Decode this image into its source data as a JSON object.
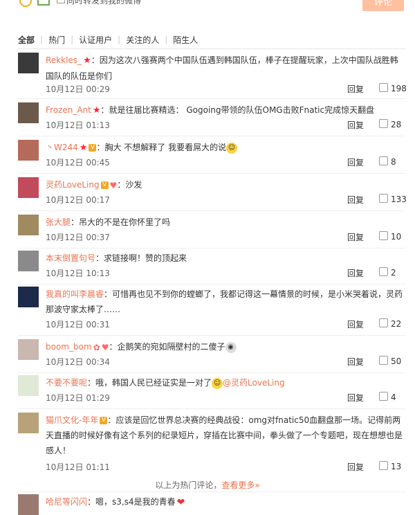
{
  "topbar": {
    "checkbox_label": "同时转发到我的微博",
    "submit_label": "评论"
  },
  "tabs": [
    "全部",
    "热门",
    "认证用户",
    "关注的人",
    "陌生人"
  ],
  "comments": [
    {
      "user": "Rekkles_",
      "text": "因为这次八强赛两个中国队伍遇到韩国队伍，棒子在提醒玩家，上次中国队战胜韩国队的队伍是你们",
      "time": "10月12日 00:29",
      "reply": "回复",
      "likes": "198",
      "avatar": "#3a3a3a"
    },
    {
      "user": "Frozen_Ant",
      "text": "就是往届比赛精选： Gogoing带领的队伍OMG击败Fnatic完成惊天翻盘",
      "time": "10月12日 01:13",
      "reply": "回复",
      "likes": "28",
      "avatar": "#6b5a4c"
    },
    {
      "user": "丶W244",
      "text": "胸大 不想解释了 我要看屌大的说",
      "time": "10月12日 00:45",
      "reply": "回复",
      "likes": "8",
      "avatar": "#b56a5a"
    },
    {
      "user": "灵药LoveLing",
      "text": "沙发",
      "time": "10月12日 00:17",
      "reply": "回复",
      "likes": "133",
      "avatar": "#c24b5b"
    },
    {
      "user": "张大腿",
      "text": "吊大的不是在你怀里了吗",
      "time": "10月12日 00:37",
      "reply": "回复",
      "likes": "10",
      "avatar": "#a08a60"
    },
    {
      "user": "本末倒置句号",
      "text": "求链接啊！赞的顶起来",
      "time": "10月12日 10:13",
      "reply": "回复",
      "likes": "2",
      "avatar": "#8a8a8a"
    },
    {
      "user": "我真的叫李晨睿",
      "text": "可惜再也见不到你的螳螂了，我都记得这一幕情景的时候，是小米哭着说，灵药那波守家太棒了……",
      "time": "10月12日 00:31",
      "reply": "回复",
      "likes": "22",
      "avatar": "#1e2a4a"
    },
    {
      "user": "boom_bom",
      "text": "企鹅笑的宛如隔壁村的二傻子",
      "time": "10月12日 00:34",
      "reply": "回复",
      "likes": "50",
      "avatar": "#c9b8b0"
    },
    {
      "user": "不要不要呢",
      "text": "哦，韩国人民已经证实是一对了",
      "mention": "@灵药LoveLing",
      "time": "10月12日 01:29",
      "reply": "回复",
      "likes": "4",
      "avatar": "#dfe9d6"
    },
    {
      "user": "猫爪文化-年年",
      "text": "应该是回忆世界总决赛的经典战役：omg对fnatic50血翻盘那一场。记得前两天直播的时候好像有这个系列的纪录短片，穿插在比赛中间，拳头做了一个专题吧，现在想想也是感人！",
      "time": "10月12日 01:11",
      "reply": "回复",
      "likes": "13",
      "avatar": "#b8a27a"
    }
  ],
  "footer": {
    "text": "以上为热门评论，",
    "link": "查看更多»"
  },
  "last": {
    "user": "哈尼等闪闪",
    "text": "嗯，s3,s4是我的青春",
    "avatar": "#9a7a70"
  }
}
